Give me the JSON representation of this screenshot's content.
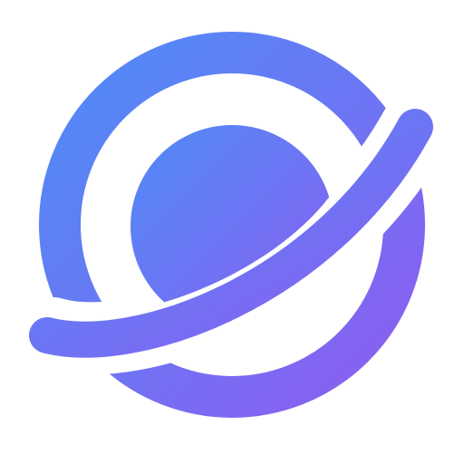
{
  "logo": {
    "icon": "planet-icon",
    "colors": {
      "gradient_start": "#4f8cf7",
      "gradient_mid": "#6f73f3",
      "gradient_end": "#8e5cf0",
      "background": "#ffffff"
    }
  }
}
